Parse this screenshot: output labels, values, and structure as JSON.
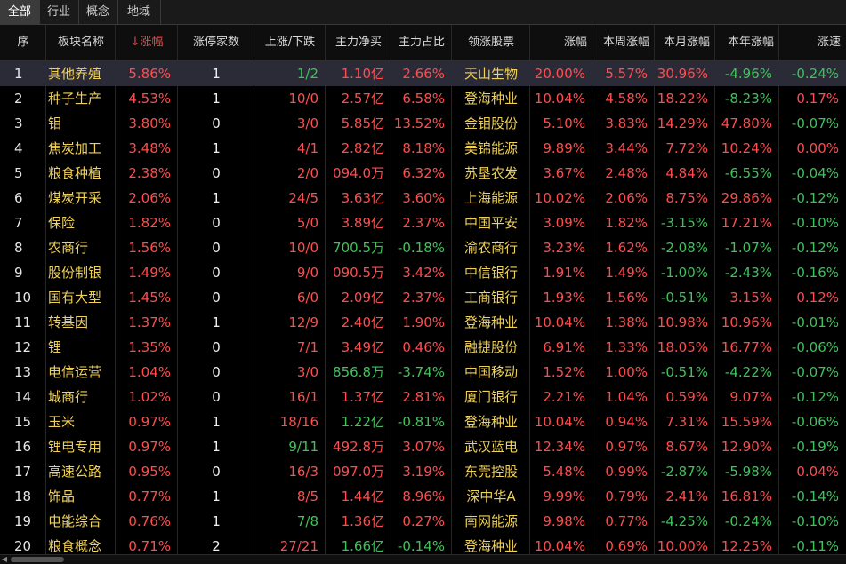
{
  "tabs": [
    "全部",
    "行业",
    "概念",
    "地域"
  ],
  "columns": [
    "序",
    "板块名称",
    "涨幅",
    "涨停家数",
    "上涨/下跌",
    "主力净买",
    "主力占比",
    "领涨股票",
    "涨幅",
    "本周涨幅",
    "本月涨幅",
    "本年涨幅",
    "涨速"
  ],
  "sort_indicator": "↓",
  "colors": {
    "up": "#ff4d4d",
    "down": "#3ec35a",
    "flat": "#e6e6e6",
    "name": "#f0d15a"
  },
  "rows": [
    [
      "1",
      "其他养殖",
      "5.86%",
      "1",
      "1/2",
      "1.10亿",
      "2.66%",
      "天山生物",
      "20.00%",
      "5.57%",
      "30.96%",
      "-4.96%",
      "-0.24%"
    ],
    [
      "2",
      "种子生产",
      "4.53%",
      "1",
      "10/0",
      "2.57亿",
      "6.58%",
      "登海种业",
      "10.04%",
      "4.58%",
      "18.22%",
      "-8.23%",
      "0.17%"
    ],
    [
      "3",
      "钼",
      "3.80%",
      "0",
      "3/0",
      "5.85亿",
      "13.52%",
      "金钼股份",
      "5.10%",
      "3.83%",
      "14.29%",
      "47.80%",
      "-0.07%"
    ],
    [
      "4",
      "焦炭加工",
      "3.48%",
      "1",
      "4/1",
      "2.82亿",
      "8.18%",
      "美锦能源",
      "9.89%",
      "3.44%",
      "7.72%",
      "10.24%",
      "0.00%"
    ],
    [
      "5",
      "粮食种植",
      "2.38%",
      "0",
      "2/0",
      "094.0万",
      "6.32%",
      "苏垦农发",
      "3.67%",
      "2.48%",
      "4.84%",
      "-6.55%",
      "-0.04%"
    ],
    [
      "6",
      "煤炭开采",
      "2.06%",
      "1",
      "24/5",
      "3.63亿",
      "3.60%",
      "上海能源",
      "10.02%",
      "2.06%",
      "8.75%",
      "29.86%",
      "-0.12%"
    ],
    [
      "7",
      "保险",
      "1.82%",
      "0",
      "5/0",
      "3.89亿",
      "2.37%",
      "中国平安",
      "3.09%",
      "1.82%",
      "-3.15%",
      "17.21%",
      "-0.10%"
    ],
    [
      "8",
      "农商行",
      "1.56%",
      "0",
      "10/0",
      "700.5万",
      "-0.18%",
      "渝农商行",
      "3.23%",
      "1.62%",
      "-2.08%",
      "-1.07%",
      "-0.12%"
    ],
    [
      "9",
      "股份制银",
      "1.49%",
      "0",
      "9/0",
      "090.5万",
      "3.42%",
      "中信银行",
      "1.91%",
      "1.49%",
      "-1.00%",
      "-2.43%",
      "-0.16%"
    ],
    [
      "10",
      "国有大型",
      "1.45%",
      "0",
      "6/0",
      "2.09亿",
      "2.37%",
      "工商银行",
      "1.93%",
      "1.56%",
      "-0.51%",
      "3.15%",
      "0.12%"
    ],
    [
      "11",
      "转基因",
      "1.37%",
      "1",
      "12/9",
      "2.40亿",
      "1.90%",
      "登海种业",
      "10.04%",
      "1.38%",
      "10.98%",
      "10.96%",
      "-0.01%"
    ],
    [
      "12",
      "锂",
      "1.35%",
      "0",
      "7/1",
      "3.49亿",
      "0.46%",
      "融捷股份",
      "6.91%",
      "1.33%",
      "18.05%",
      "16.77%",
      "-0.06%"
    ],
    [
      "13",
      "电信运营",
      "1.04%",
      "0",
      "3/0",
      "856.8万",
      "-3.74%",
      "中国移动",
      "1.52%",
      "1.00%",
      "-0.51%",
      "-4.22%",
      "-0.07%"
    ],
    [
      "14",
      "城商行",
      "1.02%",
      "0",
      "16/1",
      "1.37亿",
      "2.81%",
      "厦门银行",
      "2.21%",
      "1.04%",
      "0.59%",
      "9.07%",
      "-0.12%"
    ],
    [
      "15",
      "玉米",
      "0.97%",
      "1",
      "18/16",
      "1.22亿",
      "-0.81%",
      "登海种业",
      "10.04%",
      "0.94%",
      "7.31%",
      "15.59%",
      "-0.06%"
    ],
    [
      "16",
      "锂电专用",
      "0.97%",
      "1",
      "9/11",
      "492.8万",
      "3.07%",
      "武汉蓝电",
      "12.34%",
      "0.97%",
      "8.67%",
      "12.90%",
      "-0.19%"
    ],
    [
      "17",
      "高速公路",
      "0.95%",
      "0",
      "16/3",
      "097.0万",
      "3.19%",
      "东莞控股",
      "5.48%",
      "0.99%",
      "-2.87%",
      "-5.98%",
      "0.04%"
    ],
    [
      "18",
      "饰品",
      "0.77%",
      "1",
      "8/5",
      "1.44亿",
      "8.96%",
      "深中华A",
      "9.99%",
      "0.79%",
      "2.41%",
      "16.81%",
      "-0.14%"
    ],
    [
      "19",
      "电能综合",
      "0.76%",
      "1",
      "7/8",
      "1.36亿",
      "0.27%",
      "南网能源",
      "9.98%",
      "0.77%",
      "-4.25%",
      "-0.24%",
      "-0.10%"
    ],
    [
      "20",
      "粮食概念",
      "0.71%",
      "2",
      "27/21",
      "1.66亿",
      "-0.14%",
      "登海种业",
      "10.04%",
      "0.69%",
      "10.00%",
      "12.25%",
      "-0.11%"
    ]
  ]
}
